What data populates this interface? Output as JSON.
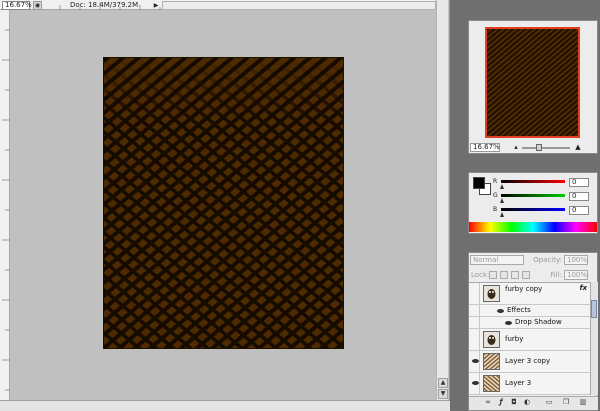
{
  "document": {
    "zoom": "16.67%",
    "doc_info": "Doc: 18.4M/379.2M",
    "artwork_colors": {
      "base": "#4d2a00",
      "stripe": "#170b00",
      "accent": "#6b3d00"
    }
  },
  "navigator": {
    "zoom": "16.67%",
    "zoom_slider_fraction": 0.35,
    "view_box_color": "#e04020"
  },
  "color": {
    "foreground": "#000000",
    "background": "#ffffff",
    "channels": [
      {
        "label": "R",
        "value": "0",
        "color": "#ff0000"
      },
      {
        "label": "G",
        "value": "0",
        "color": "#00cc00"
      },
      {
        "label": "B",
        "value": "0",
        "color": "#0000ff"
      }
    ]
  },
  "layers": {
    "blend_mode": "Normal",
    "opacity_label": "Opacity:",
    "opacity_value": "100%",
    "lock_label": "Lock:",
    "fill_label": "Fill:",
    "fill_value": "100%",
    "items": [
      {
        "name": "furby copy",
        "visible": false,
        "fx": true,
        "fx_label": "fx"
      },
      {
        "name": "Effects",
        "kind": "effects-header"
      },
      {
        "name": "Drop Shadow",
        "kind": "effect"
      },
      {
        "name": "furby",
        "visible": false
      },
      {
        "name": "Layer 3 copy",
        "visible": true
      },
      {
        "name": "Layer 3",
        "visible": true
      }
    ]
  },
  "icons": [
    "scroll-up-icon",
    "scroll-down-icon",
    "eye-icon",
    "link-layers-icon",
    "layer-style-icon",
    "layer-mask-icon",
    "adjustment-layer-icon",
    "new-group-icon",
    "new-layer-icon",
    "trash-icon"
  ]
}
